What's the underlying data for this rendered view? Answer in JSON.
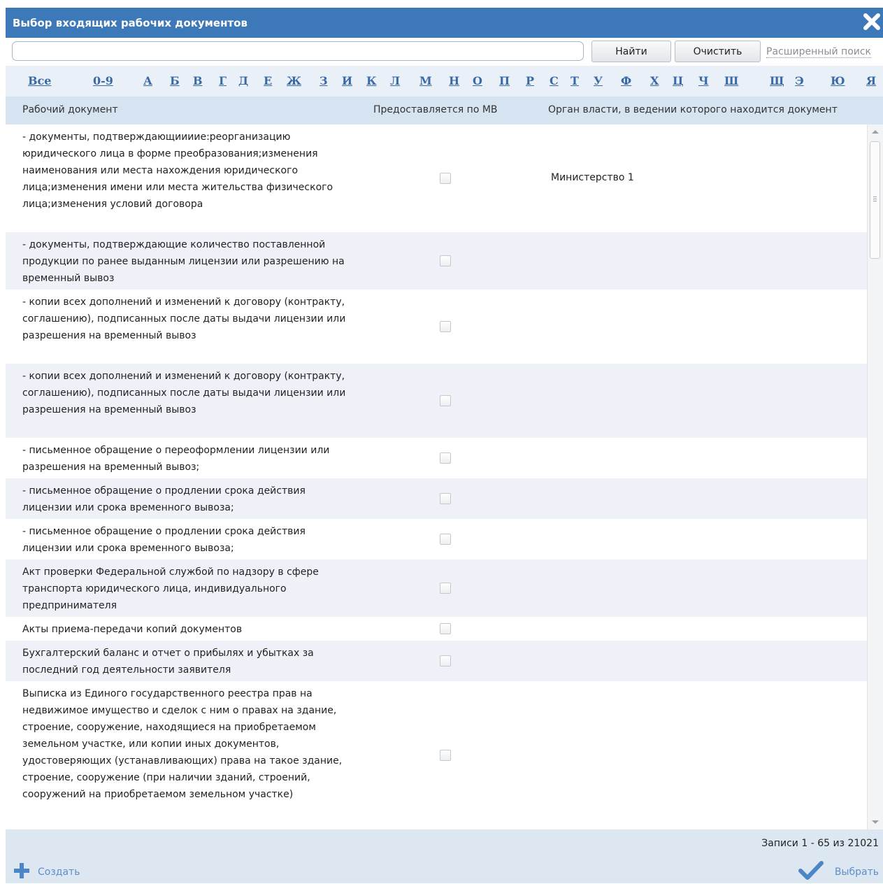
{
  "dialog": {
    "title": "Выбор входящих рабочих документов"
  },
  "search": {
    "value": "",
    "placeholder": "",
    "find_label": "Найти",
    "clear_label": "Очистить",
    "advanced_label": "Расширенный поиск"
  },
  "alphabet": [
    "Все",
    "0-9",
    "А",
    "Б",
    "В",
    "Г",
    "Д",
    "Е",
    "Ж",
    "З",
    "И",
    "К",
    "Л",
    "М",
    "Н",
    "О",
    "П",
    "Р",
    "С",
    "Т",
    "У",
    "Ф",
    "Х",
    "Ц",
    "Ч",
    "Ш",
    "Щ",
    "Э",
    "Ю",
    "Я"
  ],
  "grid": {
    "columns": {
      "doc": "Рабочий документ",
      "mv": "Предоставляется по МВ",
      "org": "Орган власти, в ведении которого находится документ"
    },
    "rows": [
      {
        "doc": "- документы, подтверждающиииие:реорганизацию юридического лица в форме преобразования;изменения наименования или места нахождения юридического лица;изменения имени или места жительства физического лица;изменения условий договора",
        "mv": false,
        "org": "Министерство 1"
      },
      {
        "doc": "- документы, подтверждающие количество поставленной продукции по ранее выданным лицензии или разрешению на временный вывоз",
        "mv": false,
        "org": ""
      },
      {
        "doc": "- копии всех дополнений и изменений к договору (контракту, соглашению), подписанных после даты выдачи лицензии или разрешения на временный вывоз",
        "mv": false,
        "org": ""
      },
      {
        "doc": "- копии всех дополнений и изменений к договору (контракту, соглашению), подписанных после даты выдачи лицензии или разрешения на временный вывоз",
        "mv": false,
        "org": ""
      },
      {
        "doc": "- письменное обращение о переоформлении лицензии или разрешения на временный вывоз;",
        "mv": false,
        "org": ""
      },
      {
        "doc": "- письменное обращение о продлении срока действия лицензии или срока временного вывоза;",
        "mv": false,
        "org": ""
      },
      {
        "doc": "- письменное обращение о продлении срока действия лицензии или срока временного вывоза;",
        "mv": false,
        "org": ""
      },
      {
        "doc": "Акт проверки Федеральной службой по надзору в сфере транспорта юридического лица, индивидуального предпринимателя",
        "mv": false,
        "org": ""
      },
      {
        "doc": "Акты приема-передачи копий документов",
        "mv": false,
        "org": ""
      },
      {
        "doc": "Бухгалтерский баланс и отчет о прибылях и убытках за последний год деятельности заявителя",
        "mv": false,
        "org": ""
      },
      {
        "doc": "Выписка из Единого государственного реестра прав на недвижимое имущество и сделок с ним о правах на здание, строение, сооружение, находящиеся на приобретаемом земельном участке, или копии иных документов, удостоверяющих (устанавливающих) права на такое здание, строение, сооружение (при наличии зданий, строений, сооружений на приобретаемом земельном участке)",
        "mv": false,
        "org": ""
      }
    ]
  },
  "footer": {
    "records": "Записи 1 - 65 из 21021",
    "create_label": "Создать",
    "select_label": "Выбрать"
  },
  "icons": {
    "close": "close-icon",
    "plus": "plus-icon",
    "check": "check-icon"
  },
  "colors": {
    "titlebar": "#3d78b8",
    "header": "#d6e3f1",
    "alt_row": "#eef2f8",
    "link": "#5e8fc9"
  }
}
